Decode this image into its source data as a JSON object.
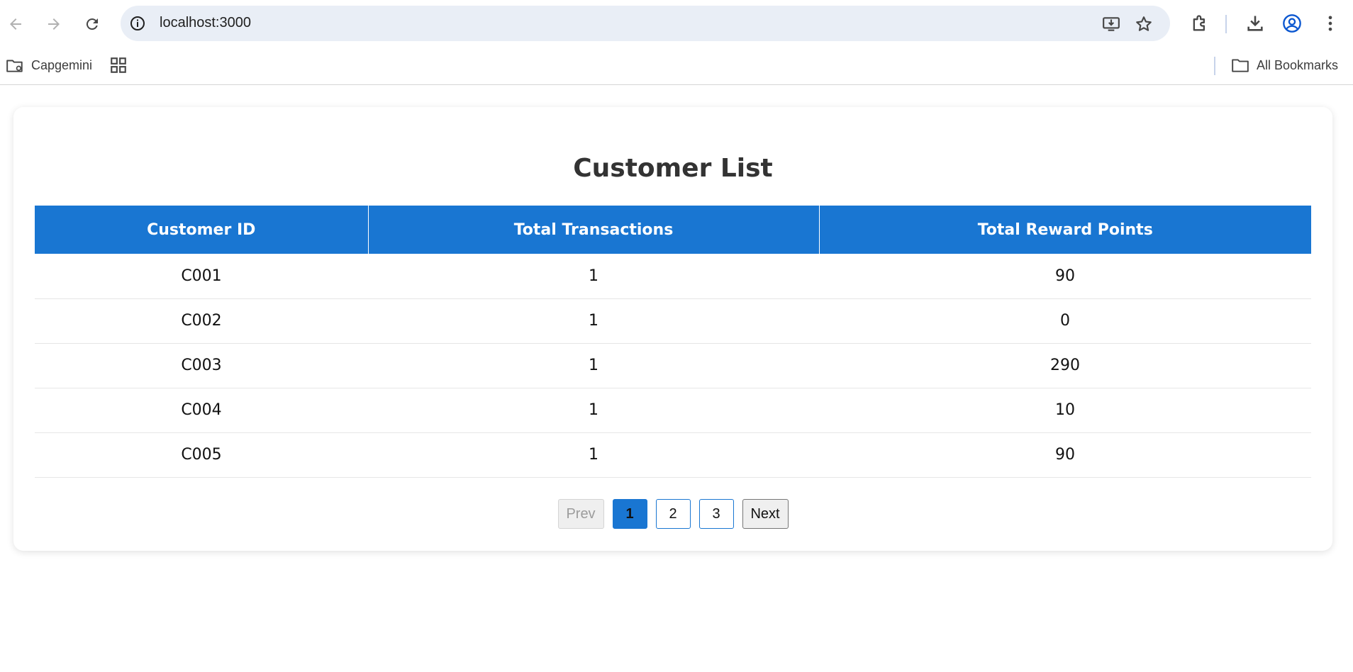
{
  "browser": {
    "url": "localhost:3000",
    "bookmarks": [
      {
        "label": "Capgemini",
        "icon": "folder-settings-icon"
      }
    ],
    "all_bookmarks_label": "All Bookmarks"
  },
  "page": {
    "title": "Customer List",
    "table": {
      "columns": [
        "Customer ID",
        "Total Transactions",
        "Total Reward Points"
      ],
      "rows": [
        [
          "C001",
          "1",
          "90"
        ],
        [
          "C002",
          "1",
          "0"
        ],
        [
          "C003",
          "1",
          "290"
        ],
        [
          "C004",
          "1",
          "10"
        ],
        [
          "C005",
          "1",
          "90"
        ]
      ]
    },
    "pagination": {
      "prev_label": "Prev",
      "pages": [
        "1",
        "2",
        "3"
      ],
      "current_page": "1",
      "next_label": "Next"
    }
  },
  "colors": {
    "accent": "#1976d2",
    "omnibox_bg": "#e9eef6",
    "header_text": "#ffffff"
  }
}
